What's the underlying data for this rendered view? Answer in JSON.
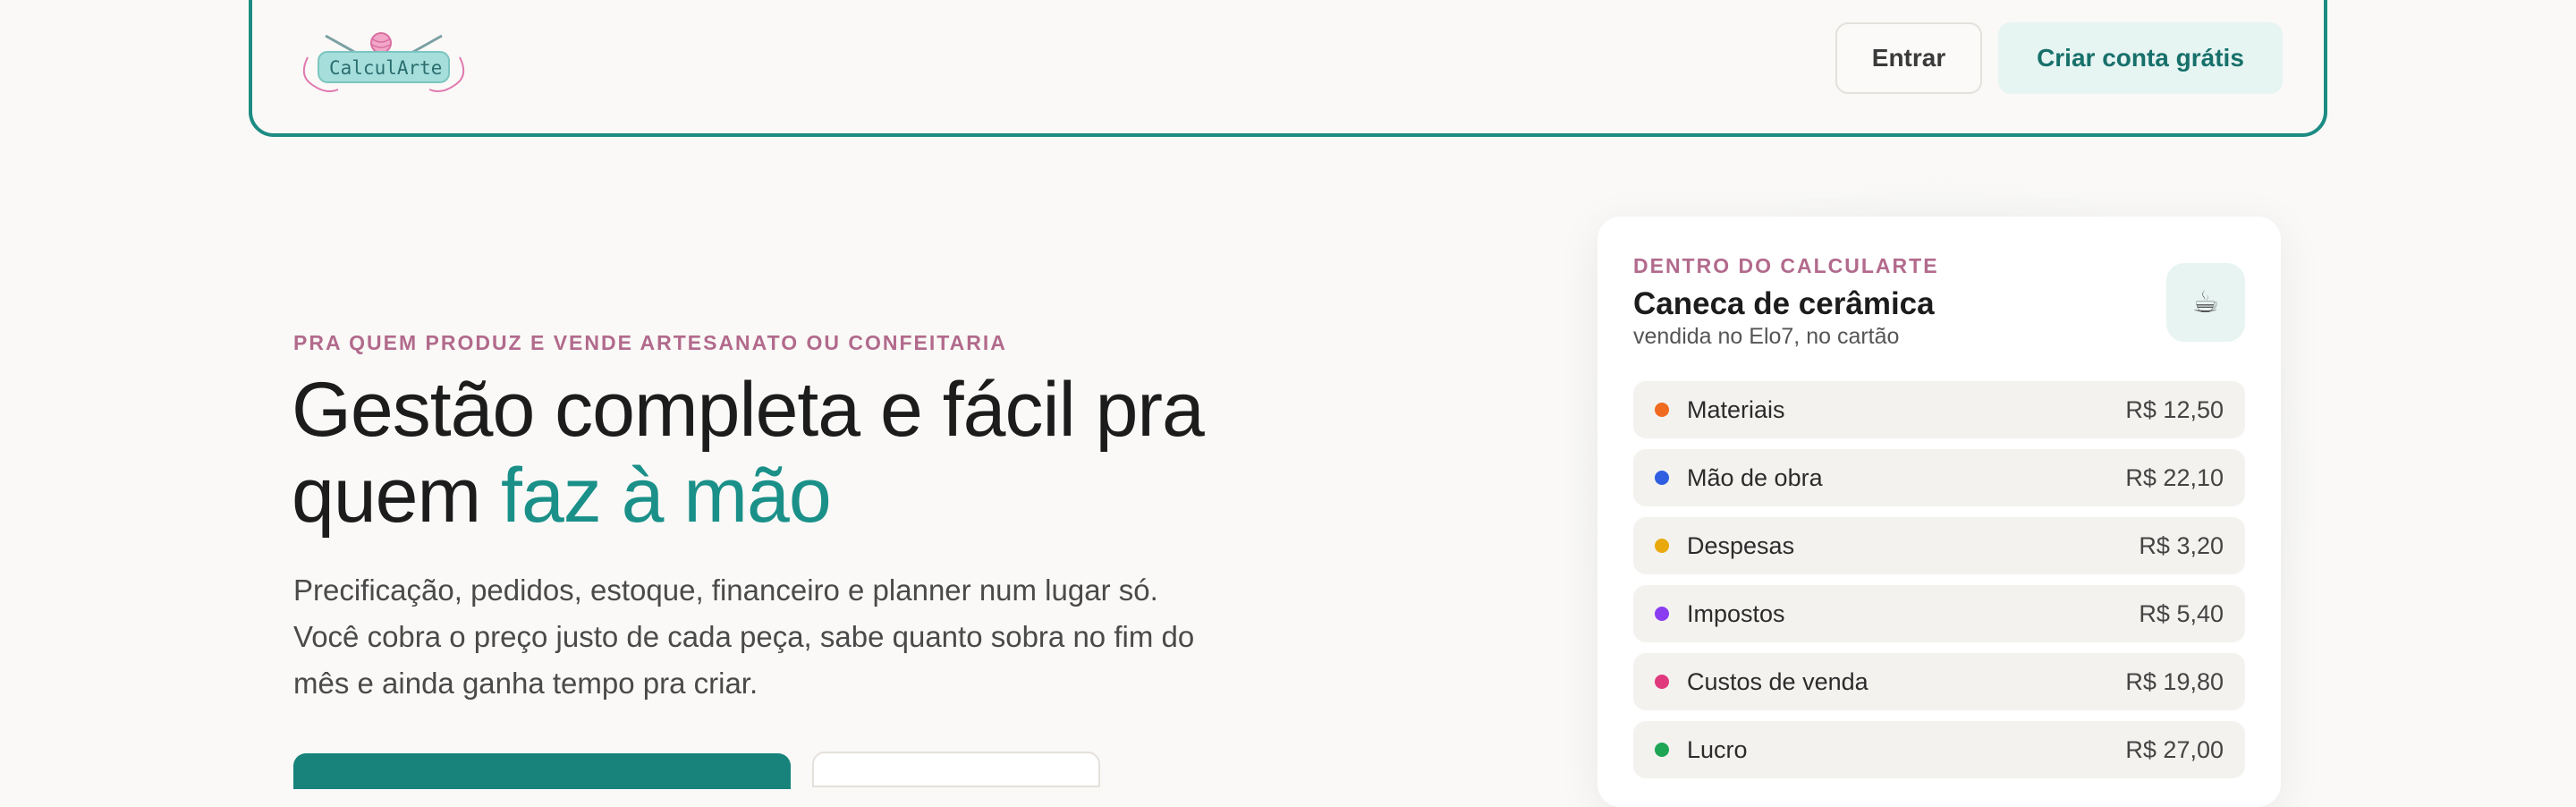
{
  "header": {
    "logo_text": "CalculArte",
    "login_label": "Entrar",
    "signup_label": "Criar conta grátis"
  },
  "hero": {
    "eyebrow": "PRA QUEM PRODUZ E VENDE ARTESANATO OU CONFEITARIA",
    "headline_part1": "Gestão completa e fácil pra quem",
    "headline_accent": "faz à mão",
    "lead": "Precificação, pedidos, estoque, financeiro e planner num lugar só. Você cobra o preço justo de cada peça, sabe quanto sobra no fim do mês e ainda ganha tempo pra criar."
  },
  "card": {
    "eyebrow": "DENTRO DO CALCULARTE",
    "title": "Caneca de cerâmica",
    "subtitle": "vendida no Elo7, no cartão",
    "icon": "coffee-cup-icon",
    "items": [
      {
        "label": "Materiais",
        "value": "R$ 12,50",
        "color": "#f06a1f"
      },
      {
        "label": "Mão de obra",
        "value": "R$ 22,10",
        "color": "#2f5fe0"
      },
      {
        "label": "Despesas",
        "value": "R$ 3,20",
        "color": "#e9a90d"
      },
      {
        "label": "Impostos",
        "value": "R$ 5,40",
        "color": "#8a3df0"
      },
      {
        "label": "Custos de venda",
        "value": "R$ 19,80",
        "color": "#e03a7d"
      },
      {
        "label": "Lucro",
        "value": "R$ 27,00",
        "color": "#1ea655"
      }
    ]
  },
  "colors": {
    "accent": "#1a9089",
    "eyebrow": "#b26a8c",
    "background": "#faf9f7"
  }
}
